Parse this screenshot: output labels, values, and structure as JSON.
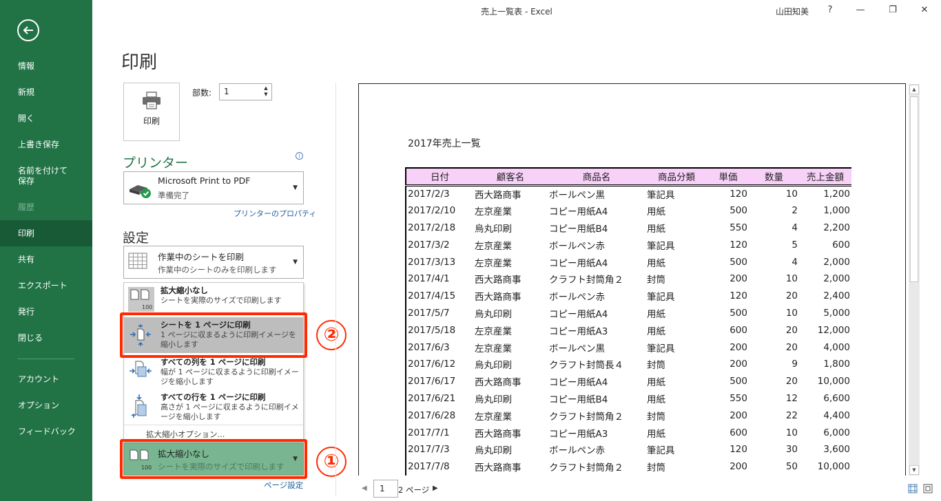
{
  "window": {
    "title": "売上一覧表 - Excel",
    "user": "山田知美",
    "help": "?",
    "minimize": "—",
    "restore": "❐",
    "close": "✕"
  },
  "sidebar": {
    "items": [
      {
        "label": "情報"
      },
      {
        "label": "新規"
      },
      {
        "label": "開く"
      },
      {
        "label": "上書き保存"
      },
      {
        "label": "名前を付けて"
      },
      {
        "label": "保存"
      },
      {
        "label": "履歴"
      },
      {
        "label": "印刷"
      },
      {
        "label": "共有"
      },
      {
        "label": "エクスポート"
      },
      {
        "label": "発行"
      },
      {
        "label": "閉じる"
      },
      {
        "label": "アカウント"
      },
      {
        "label": "オプション"
      },
      {
        "label": "フィードバック"
      }
    ]
  },
  "print": {
    "title": "印刷",
    "button_label": "印刷",
    "copies_label": "部数:",
    "copies_value": "1",
    "printer_heading": "プリンター",
    "info_glyph": "i",
    "printer_name": "Microsoft Print to PDF",
    "printer_status": "準備完了",
    "printer_props": "プリンターのプロパティ",
    "settings_heading": "設定",
    "sheet_title": "作業中のシートを印刷",
    "sheet_sub": "作業中のシートのみを印刷します",
    "page_setup": "ページ設定",
    "scale_selected_title": "拡大縮小なし",
    "scale_selected_sub": "シートを実際のサイズで印刷します"
  },
  "scale_menu": {
    "no_scaling_title": "拡大縮小なし",
    "no_scaling_sub": "シートを実際のサイズで印刷します",
    "fit_page_title": "シートを 1 ページに印刷",
    "fit_page_sub": "1 ページに収まるように印刷イメージを縮小します",
    "fit_cols_title": "すべての列を 1 ページに印刷",
    "fit_cols_sub": "幅が 1 ページに収まるように印刷イメージを縮小します",
    "fit_rows_title": "すべての行を 1 ページに印刷",
    "fit_rows_sub": "高さが 1 ページに収まるように印刷イメージを縮小します",
    "options_link": "拡大縮小オプション...",
    "icon_badge": "100"
  },
  "callouts": {
    "one": "①",
    "two": "②"
  },
  "preview": {
    "sheet_title": "2017年売上一覧",
    "headers": [
      "日付",
      "顧客名",
      "商品名",
      "商品分類",
      "単価",
      "数量",
      "売上金額"
    ],
    "rows": [
      [
        "2017/2/3",
        "西大路商事",
        "ボールペン黒",
        "筆記具",
        "120",
        "10",
        "1,200"
      ],
      [
        "2017/2/10",
        "左京産業",
        "コピー用紙A4",
        "用紙",
        "500",
        "2",
        "1,000"
      ],
      [
        "2017/2/18",
        "烏丸印刷",
        "コピー用紙B4",
        "用紙",
        "550",
        "4",
        "2,200"
      ],
      [
        "2017/3/2",
        "左京産業",
        "ボールペン赤",
        "筆記具",
        "120",
        "5",
        "600"
      ],
      [
        "2017/3/13",
        "左京産業",
        "コピー用紙A4",
        "用紙",
        "500",
        "4",
        "2,000"
      ],
      [
        "2017/4/1",
        "西大路商事",
        "クラフト封筒角２",
        "封筒",
        "200",
        "10",
        "2,000"
      ],
      [
        "2017/4/15",
        "西大路商事",
        "ボールペン赤",
        "筆記具",
        "120",
        "20",
        "2,400"
      ],
      [
        "2017/5/7",
        "烏丸印刷",
        "コピー用紙A4",
        "用紙",
        "500",
        "10",
        "5,000"
      ],
      [
        "2017/5/18",
        "左京産業",
        "コピー用紙A3",
        "用紙",
        "600",
        "20",
        "12,000"
      ],
      [
        "2017/6/3",
        "左京産業",
        "ボールペン黒",
        "筆記具",
        "200",
        "20",
        "4,000"
      ],
      [
        "2017/6/12",
        "烏丸印刷",
        "クラフト封筒長４",
        "封筒",
        "200",
        "9",
        "1,800"
      ],
      [
        "2017/6/17",
        "西大路商事",
        "コピー用紙A4",
        "用紙",
        "500",
        "20",
        "10,000"
      ],
      [
        "2017/6/21",
        "烏丸印刷",
        "コピー用紙B4",
        "用紙",
        "550",
        "12",
        "6,600"
      ],
      [
        "2017/6/28",
        "左京産業",
        "クラフト封筒角２",
        "封筒",
        "200",
        "22",
        "4,400"
      ],
      [
        "2017/7/1",
        "西大路商事",
        "コピー用紙A3",
        "用紙",
        "600",
        "10",
        "6,000"
      ],
      [
        "2017/7/3",
        "烏丸印刷",
        "ボールペン赤",
        "筆記具",
        "120",
        "30",
        "3,600"
      ],
      [
        "2017/7/8",
        "西大路商事",
        "クラフト封筒角２",
        "封筒",
        "200",
        "50",
        "10,000"
      ]
    ]
  },
  "page_nav": {
    "current": "1",
    "total": "2 ページ"
  },
  "colors": {
    "sidebar": "#217346",
    "sidebar_active": "#195a36",
    "highlight": "#ff2a00",
    "header_fill": "#f7d1f7"
  }
}
